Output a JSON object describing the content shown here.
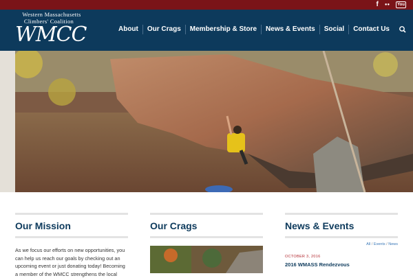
{
  "social": {
    "facebook": "f",
    "flickr": "●●",
    "youtube": "You"
  },
  "logo": {
    "line1": "Western Massachusetts",
    "line2": "Climbers' Coalition",
    "wordmark": "WMCC"
  },
  "nav": {
    "items": [
      "About",
      "Our Crags",
      "Membership & Store",
      "News & Events",
      "Social",
      "Contact Us"
    ]
  },
  "mission": {
    "title": "Our Mission",
    "text": "As we focus our efforts on new opportunities, you can help us reach our goals by checking out an upcoming event or just donating today! Becoming a member of the WMCC strengthens the local"
  },
  "crags": {
    "title": "Our Crags"
  },
  "news": {
    "title": "News & Events",
    "filters": [
      "All",
      "Events",
      "News"
    ],
    "date": "OCTOBER 3, 2016",
    "post_title": "2016 WMASS Rendezvous"
  },
  "colors": {
    "topbar": "#7a1418",
    "header": "#0d3a5c",
    "accent": "#b1262d"
  }
}
